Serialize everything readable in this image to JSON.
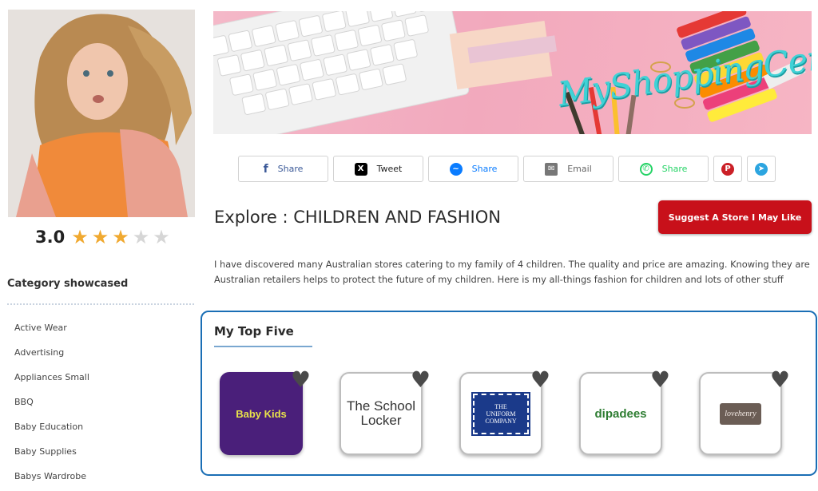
{
  "sidebar": {
    "rating": "3.0",
    "stars_filled": 3,
    "stars_total": 5,
    "category_title": "Category showcased",
    "categories": [
      "Active Wear",
      "Advertising",
      "Appliances Small",
      "BBQ",
      "Baby Education",
      "Baby Supplies",
      "Babys Wardrobe"
    ]
  },
  "banner": {
    "title": "MyShoppingCentre"
  },
  "share": {
    "buttons": [
      {
        "label": "Share",
        "icon": "facebook-icon",
        "color": "#3b5998"
      },
      {
        "label": "Tweet",
        "icon": "x-icon",
        "color": "#000000"
      },
      {
        "label": "Share",
        "icon": "messenger-icon",
        "color": "#0a7cff"
      },
      {
        "label": "Email",
        "icon": "email-icon",
        "color": "#777777"
      },
      {
        "label": "Share",
        "icon": "whatsapp-icon",
        "color": "#25d366"
      },
      {
        "label": "",
        "icon": "pinterest-icon",
        "color": "#cb2027"
      },
      {
        "label": "",
        "icon": "telegram-icon",
        "color": "#2ca5e0"
      }
    ]
  },
  "main": {
    "title": "Explore : CHILDREN AND FASHION",
    "suggest_button": "Suggest A Store I May Like",
    "description": "I have discovered many Australian stores catering to my family of 4 children. The quality and price are amazing. Knowing they are Australian retailers helps to protect the future of my children. Here is my all-things fashion for children and lots of other stuff"
  },
  "top_five": {
    "title": "My Top Five",
    "stores": [
      {
        "logo_text": "Baby Kids",
        "bg": "#4a1f7a",
        "fg": "#e8e24a"
      },
      {
        "logo_text": "The School Locker",
        "bg": "#ffffff",
        "fg": "#333333"
      },
      {
        "logo_text": "THE UNIFORM COMPANY",
        "bg": "#ffffff",
        "fg": "#1b3a8a"
      },
      {
        "logo_text": "dipadees",
        "bg": "#ffffff",
        "fg": "#2e7d32"
      },
      {
        "logo_text": "lovehenry",
        "bg": "#ffffff",
        "fg": "#6b5d55"
      }
    ]
  },
  "colors": {
    "accent_red": "#c8101a",
    "panel_border": "#1a6eb5",
    "star": "#f0a930"
  }
}
